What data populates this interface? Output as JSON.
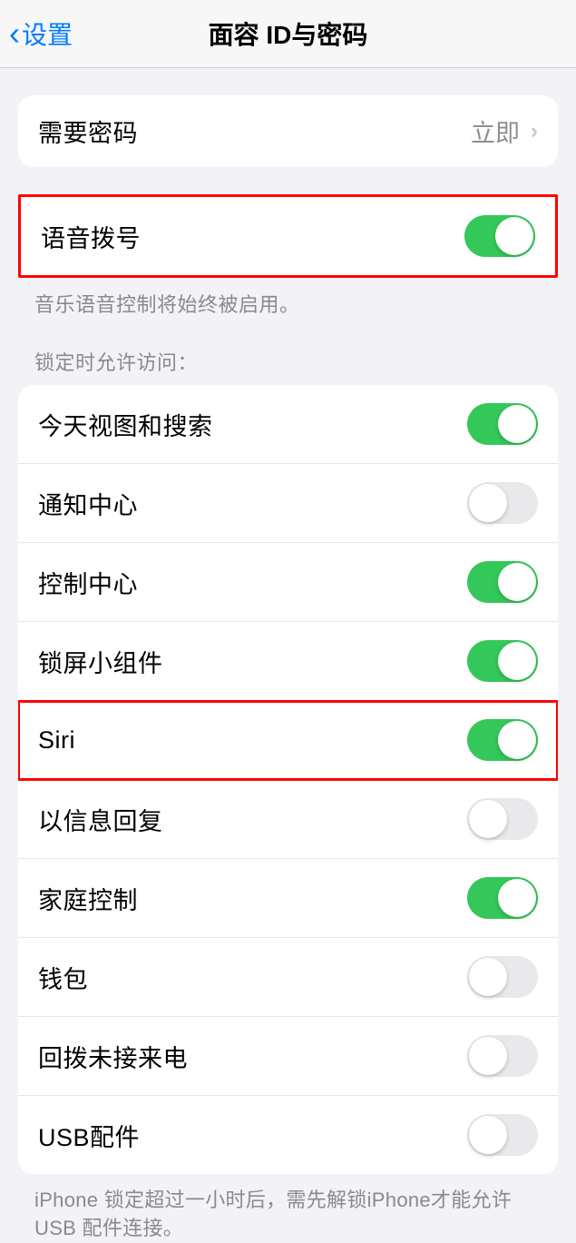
{
  "nav": {
    "back_label": "设置",
    "title": "面容 ID与密码"
  },
  "passcode_section": {
    "label": "需要密码",
    "value": "立即"
  },
  "voice_dial": {
    "label": "语音拨号",
    "on": true,
    "caption": "音乐语音控制将始终被启用。"
  },
  "lock_access": {
    "header": "锁定时允许访问：",
    "items": [
      {
        "label": "今天视图和搜索",
        "on": true
      },
      {
        "label": "通知中心",
        "on": false
      },
      {
        "label": "控制中心",
        "on": true
      },
      {
        "label": "锁屏小组件",
        "on": true
      },
      {
        "label": "Siri",
        "on": true
      },
      {
        "label": "以信息回复",
        "on": false
      },
      {
        "label": "家庭控制",
        "on": true
      },
      {
        "label": "钱包",
        "on": false
      },
      {
        "label": "回拨未接来电",
        "on": false
      },
      {
        "label": "USB配件",
        "on": false
      }
    ],
    "footer": "iPhone 锁定超过一小时后，需先解锁iPhone才能允许USB 配件连接。"
  }
}
